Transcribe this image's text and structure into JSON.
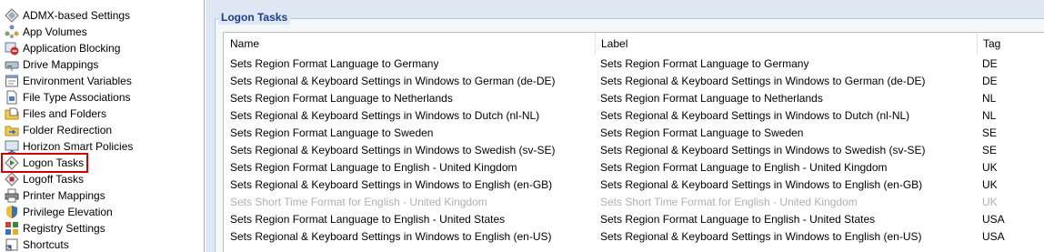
{
  "nav": {
    "items": [
      {
        "label": "ADMX-based Settings",
        "icon": "admx-settings-icon",
        "selected": false
      },
      {
        "label": "App Volumes",
        "icon": "app-volumes-icon",
        "selected": false
      },
      {
        "label": "Application Blocking",
        "icon": "application-blocking-icon",
        "selected": false
      },
      {
        "label": "Drive Mappings",
        "icon": "drive-mappings-icon",
        "selected": false
      },
      {
        "label": "Environment Variables",
        "icon": "environment-variables-icon",
        "selected": false
      },
      {
        "label": "File Type Associations",
        "icon": "file-type-associations-icon",
        "selected": false
      },
      {
        "label": "Files and Folders",
        "icon": "files-and-folders-icon",
        "selected": false
      },
      {
        "label": "Folder Redirection",
        "icon": "folder-redirection-icon",
        "selected": false
      },
      {
        "label": "Horizon Smart Policies",
        "icon": "horizon-smart-policies-icon",
        "selected": false
      },
      {
        "label": "Logon Tasks",
        "icon": "logon-tasks-icon",
        "selected": true
      },
      {
        "label": "Logoff Tasks",
        "icon": "logoff-tasks-icon",
        "selected": false
      },
      {
        "label": "Printer Mappings",
        "icon": "printer-mappings-icon",
        "selected": false
      },
      {
        "label": "Privilege Elevation",
        "icon": "privilege-elevation-icon",
        "selected": false
      },
      {
        "label": "Registry Settings",
        "icon": "registry-settings-icon",
        "selected": false
      },
      {
        "label": "Shortcuts",
        "icon": "shortcuts-icon",
        "selected": false
      }
    ]
  },
  "panel": {
    "title": "Logon Tasks",
    "columns": {
      "name": "Name",
      "label": "Label",
      "tag": "Tag"
    },
    "rows": [
      {
        "name": "Sets Region Format Language to Germany",
        "label": "Sets Region Format Language to Germany",
        "tag": "DE",
        "disabled": false
      },
      {
        "name": "Sets Regional & Keyboard Settings in Windows to German (de-DE)",
        "label": "Sets Regional & Keyboard Settings in Windows to German (de-DE)",
        "tag": "DE",
        "disabled": false
      },
      {
        "name": "Sets Region Format Language to Netherlands",
        "label": "Sets Region Format Language to Netherlands",
        "tag": "NL",
        "disabled": false
      },
      {
        "name": "Sets Regional & Keyboard Settings in Windows to Dutch (nl-NL)",
        "label": "Sets Regional & Keyboard Settings in Windows to Dutch (nl-NL)",
        "tag": "NL",
        "disabled": false
      },
      {
        "name": "Sets Region Format Language to Sweden",
        "label": "Sets Region Format Language to Sweden",
        "tag": "SE",
        "disabled": false
      },
      {
        "name": "Sets Regional & Keyboard Settings in Windows to Swedish (sv-SE)",
        "label": "Sets Regional & Keyboard Settings in Windows to Swedish (sv-SE)",
        "tag": "SE",
        "disabled": false
      },
      {
        "name": "Sets Region Format Language to English - United Kingdom",
        "label": "Sets Region Format Language to English - United Kingdom",
        "tag": "UK",
        "disabled": false
      },
      {
        "name": "Sets Regional & Keyboard Settings in Windows to English (en-GB)",
        "label": "Sets Regional & Keyboard Settings in Windows to English (en-GB)",
        "tag": "UK",
        "disabled": false
      },
      {
        "name": "Sets Short Time Format for English - United Kingdom",
        "label": "Sets Short Time Format for English - United Kingdom",
        "tag": "UK",
        "disabled": true
      },
      {
        "name": "Sets Region Format Language to English - United States",
        "label": "Sets Region Format Language to English - United States",
        "tag": "USA",
        "disabled": false
      },
      {
        "name": "Sets Regional & Keyboard Settings in Windows to English (en-US)",
        "label": "Sets Regional & Keyboard Settings in Windows to English (en-US)",
        "tag": "USA",
        "disabled": false
      }
    ]
  },
  "colors": {
    "panel_background": "#dfe8f2",
    "panel_title": "#1a3e8a",
    "selection_outline": "#d40000",
    "disabled_text": "#b0b0b0"
  }
}
